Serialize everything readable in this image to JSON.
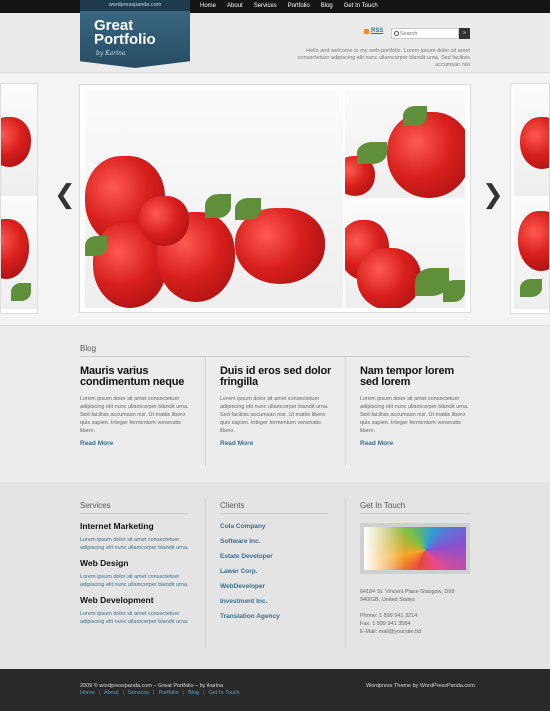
{
  "nav": [
    "Home",
    "About",
    "Services",
    "Portfolio",
    "Blog",
    "Get In Touch"
  ],
  "logo": {
    "site": "wordpresspanda.com",
    "line1": "Great",
    "line2": "Portfolio",
    "signature": "by Karina"
  },
  "rss_label": "RSS",
  "search": {
    "placeholder": "Search",
    "button": "»"
  },
  "welcome": "Hello and welcome to my web-portfolio. Lorem ipsum dolor sit amet consectetuer adipiscing elit nunc ullamcorper blandit urna. Sed facilisis accumsan nisi",
  "slider": {
    "prev": "❮",
    "next": "❯"
  },
  "blog": {
    "title": "Blog",
    "posts": [
      {
        "title": "Mauris varius condimentum neque",
        "body": "Lorem ipsum dolor sit amet consectetuer adipiscing elit nunc ullamcorper blandit urna. Sed facilisis accumsan nisi. Ut mattis libero quis sapien. Integer fermentum venenatis libero.",
        "read_more": "Read More"
      },
      {
        "title": "Duis id eros sed dolor fringilla",
        "body": "Lorem ipsum dolor sit amet consectetuer adipiscing elit nunc ullamcorper blandit urna. Sed facilisis accumsan nisi. Ut mattis libero quis sapien. Integer fermentum venenatis libero.",
        "read_more": "Read More"
      },
      {
        "title": "Nam tempor lorem sed lorem",
        "body": "Lorem ipsum dolor sit amet consectetuer adipiscing elit nunc ullamcorper blandit urna. Sed facilisis accumsan nisi. Ut mattis libero quis sapien. Integer fermentum venenatis libero.",
        "read_more": "Read More"
      }
    ]
  },
  "services": {
    "title": "Services",
    "items": [
      {
        "name": "Internet Marketing",
        "text": "Lorem ipsum dolor sit amet consectetuer adipiscing elit nunc ullamcorper blandit urna."
      },
      {
        "name": "Web Design",
        "text": "Lorem ipsum dolor sit amet consectetuer adipiscing elit nunc ullamcorper blandit urna."
      },
      {
        "name": "Web Development",
        "text": "Lorem ipsum dolor sit amet consectetuer adipiscing elit nunc ullamcorper blandit urna."
      }
    ]
  },
  "clients": {
    "title": "Clients",
    "items": [
      "Cola Company",
      "Software Inc.",
      "Estate Developer",
      "Lawer Corp.",
      "WebDeveloper",
      "Investment Inc.",
      "Translation Agency"
    ]
  },
  "contact": {
    "title": "Get In Touch",
    "address1": "64184 St. Vincent Place Glasgow, D99",
    "address2": "940IGB, United States",
    "phone": "Phone: 1 899 941 3214",
    "fax": "Fax: 1 899 941 3584",
    "email": "E-Mail: mail@yoursite.tld"
  },
  "footer": {
    "copyright": "2009 © wordpresspanda.com – Great Portfolio – by ikarina",
    "links": [
      "Home",
      "About",
      "Services",
      "Portfolio",
      "Blog",
      "Get In Touch"
    ],
    "theme": "Wordpress Theme by WordPressPanda.com"
  },
  "colors": {
    "accent": "#3a6f8e",
    "logo_bg": "#2f5b75",
    "footer_bg": "#292929",
    "topbar_bg": "#141414"
  }
}
